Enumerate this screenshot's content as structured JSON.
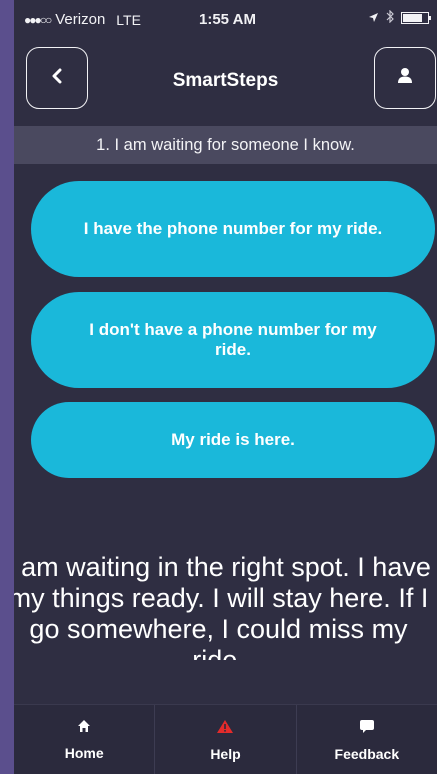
{
  "status_bar": {
    "carrier": "Verizon",
    "network": "LTE",
    "time": "1:55 AM"
  },
  "nav": {
    "title": "SmartSteps",
    "back_icon": "chevron-left-icon",
    "profile_icon": "user-icon"
  },
  "question": "1. I am waiting for someone I know.",
  "choices": [
    {
      "label": "I have the phone number for my ride."
    },
    {
      "label": "I don't have a phone number for my ride."
    },
    {
      "label": "My ride is here."
    }
  ],
  "script_text": "I am waiting in the right spot. I have my things ready. I will stay here. If I go somewhere, I could miss my ride.",
  "tabs": [
    {
      "label": "Home",
      "icon": "home-icon"
    },
    {
      "label": "Help",
      "icon": "warning-icon"
    },
    {
      "label": "Feedback",
      "icon": "chat-bubble-icon"
    }
  ],
  "colors": {
    "background": "#2f2e42",
    "accent": "#1ab8da",
    "help_icon": "#e32b2b",
    "frame": "#5b4f8d"
  }
}
